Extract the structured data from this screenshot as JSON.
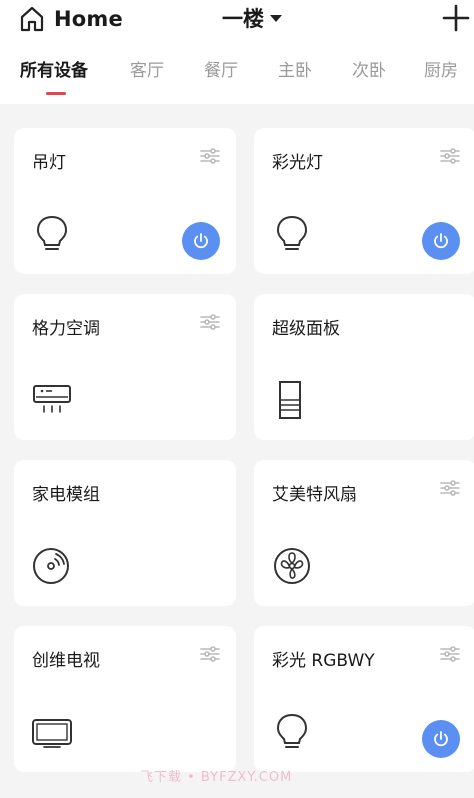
{
  "header": {
    "home_label": "Home",
    "floor_label": "一楼"
  },
  "tabs": [
    {
      "label": "所有设备",
      "active": true
    },
    {
      "label": "客厅",
      "active": false
    },
    {
      "label": "餐厅",
      "active": false
    },
    {
      "label": "主卧",
      "active": false
    },
    {
      "label": "次卧",
      "active": false
    },
    {
      "label": "厨房",
      "active": false
    }
  ],
  "devices": [
    {
      "name": "吊灯",
      "icon": "bulb-icon",
      "settings": true,
      "power": true
    },
    {
      "name": "彩光灯",
      "icon": "bulb-icon",
      "settings": true,
      "power": true
    },
    {
      "name": "格力空调",
      "icon": "air-conditioner-icon",
      "settings": true,
      "power": false
    },
    {
      "name": "超级面板",
      "icon": "panel-icon",
      "settings": false,
      "power": false
    },
    {
      "name": "家电模组",
      "icon": "appliance-module-icon",
      "settings": false,
      "power": false
    },
    {
      "name": "艾美特风扇",
      "icon": "fan-icon",
      "settings": true,
      "power": false
    },
    {
      "name": "创维电视",
      "icon": "tv-icon",
      "settings": true,
      "power": false
    },
    {
      "name": "彩光 RGBWY",
      "icon": "bulb-icon",
      "settings": true,
      "power": true
    }
  ],
  "colors": {
    "accent": "#5b8ff2",
    "tab_indicator": "#e8414a",
    "background": "#f4f4f4"
  },
  "watermark": "飞下载 • BYFZXY.COM"
}
